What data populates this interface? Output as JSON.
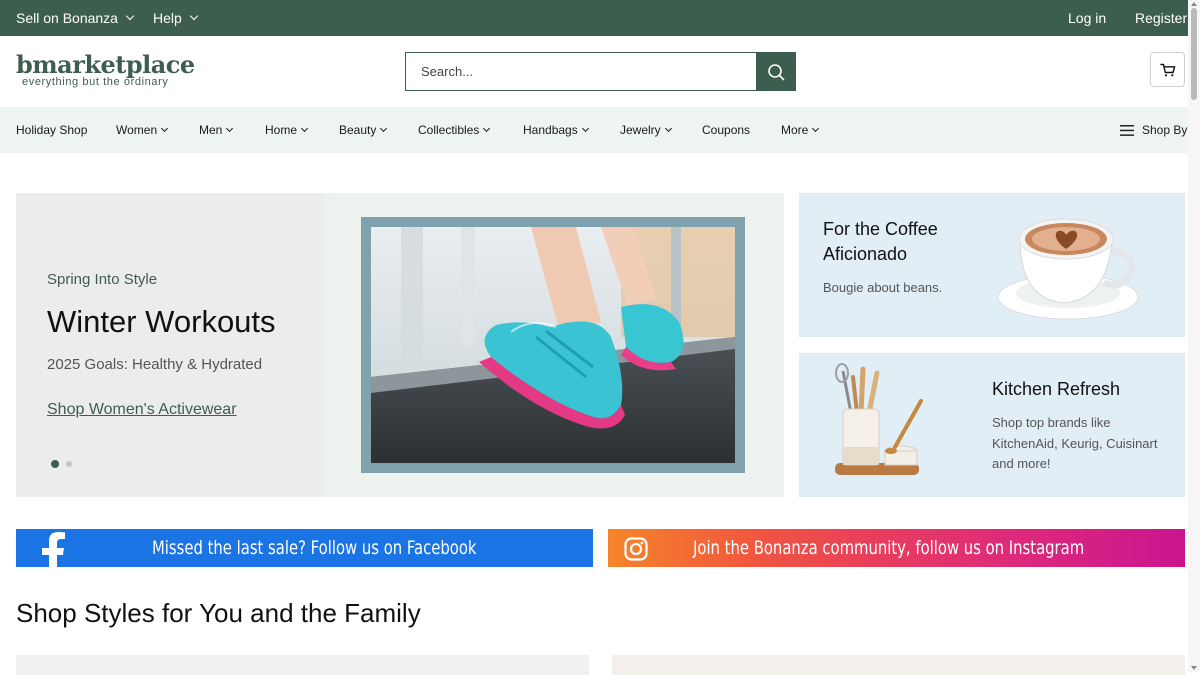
{
  "topbar": {
    "sell_label": "Sell on Bonanza",
    "help_label": "Help",
    "login_label": "Log in",
    "register_label": "Register"
  },
  "header": {
    "logo_text": "bmarketplace",
    "logo_tagline": "everything but the ordinary",
    "search_placeholder": "Search...",
    "cart_icon": "cart-icon"
  },
  "nav": {
    "items": [
      {
        "label": "Holiday Shop",
        "dropdown": false
      },
      {
        "label": "Women",
        "dropdown": true
      },
      {
        "label": "Men",
        "dropdown": true
      },
      {
        "label": "Home",
        "dropdown": true
      },
      {
        "label": "Beauty",
        "dropdown": true
      },
      {
        "label": "Collectibles",
        "dropdown": true
      },
      {
        "label": "Handbags",
        "dropdown": true
      },
      {
        "label": "Jewelry",
        "dropdown": true
      },
      {
        "label": "Coupons",
        "dropdown": false
      },
      {
        "label": "More",
        "dropdown": true
      }
    ],
    "shop_by_label": "Shop By"
  },
  "hero": {
    "eyebrow": "Spring Into Style",
    "title": "Winter Workouts",
    "subtitle": "2025 Goals: Healthy & Hydrated",
    "link_label": "Shop Women's Activewear",
    "slides_total": 2,
    "active_slide": 1
  },
  "cards": [
    {
      "title_line1": "For the Coffee",
      "title_line2": "Aficionado",
      "description": "Bougie about beans."
    },
    {
      "title": "Kitchen Refresh",
      "desc_line1": "Shop top brands like",
      "desc_line2": "KitchenAid, Keurig, Cuisinart",
      "desc_line3": "and more!"
    }
  ],
  "banners": {
    "facebook": "Missed the last sale? Follow us on Facebook",
    "instagram": "Join the Bonanza community, follow us on Instagram"
  },
  "section": {
    "title": "Shop Styles for You and the Family"
  },
  "colors": {
    "brand_green": "#3d5e4e",
    "nav_bg": "#eef4f1",
    "card_bg": "#e1eef6",
    "facebook_blue": "#1b74e4"
  }
}
